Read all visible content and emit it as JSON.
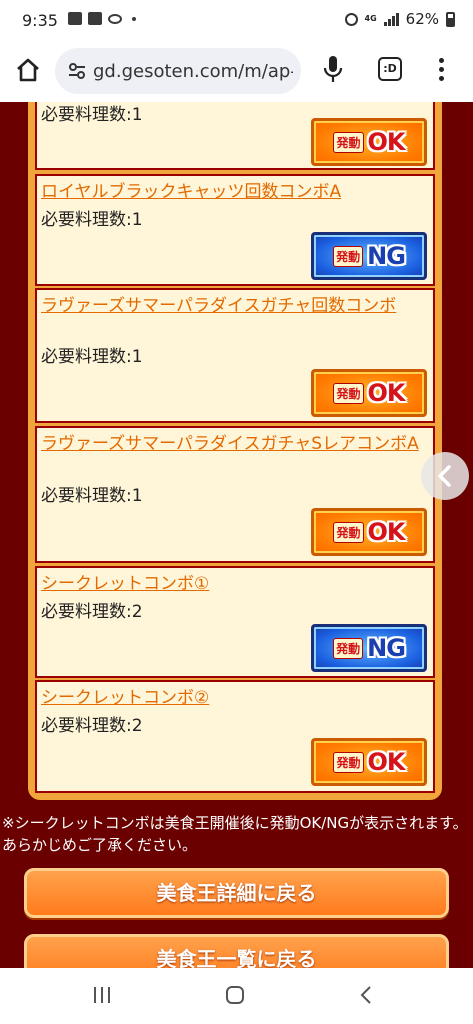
{
  "status_bar": {
    "time": "9:35",
    "network": "4G",
    "battery": "62%"
  },
  "browser": {
    "url": "gd.gesoten.com/m/ap-m",
    "tabs_label": ":D"
  },
  "combos": [
    {
      "title": "",
      "count_label": "必要料理数:1",
      "status": "OK"
    },
    {
      "title": "ロイヤルブラックキャッツ回数コンボA",
      "count_label": "必要料理数:1",
      "status": "NG"
    },
    {
      "title": "ラヴァーズサマーパラダイスガチャ回数コンボ",
      "count_label": "必要料理数:1",
      "status": "OK"
    },
    {
      "title": "ラヴァーズサマーパラダイスガチャSレアコンボA",
      "count_label": "必要料理数:1",
      "status": "OK"
    },
    {
      "title": "シークレットコンボ①",
      "count_label": "必要料理数:2",
      "status": "NG"
    },
    {
      "title": "シークレットコンボ②",
      "count_label": "必要料理数:2",
      "status": "OK"
    }
  ],
  "badge_prefix": "発動",
  "note": "※シークレットコンボは美食王開催後に発動OK/NGが表示されます。あらかじめご了承ください。",
  "buttons": {
    "back_to_detail": "美食王詳細に戻る",
    "back_to_list": "美食王一覧に戻る"
  },
  "colors": {
    "page_background": "#6b0000",
    "link": "#e26a00",
    "ok_badge": "#ff7a00",
    "ng_badge": "#1b5fe0"
  }
}
